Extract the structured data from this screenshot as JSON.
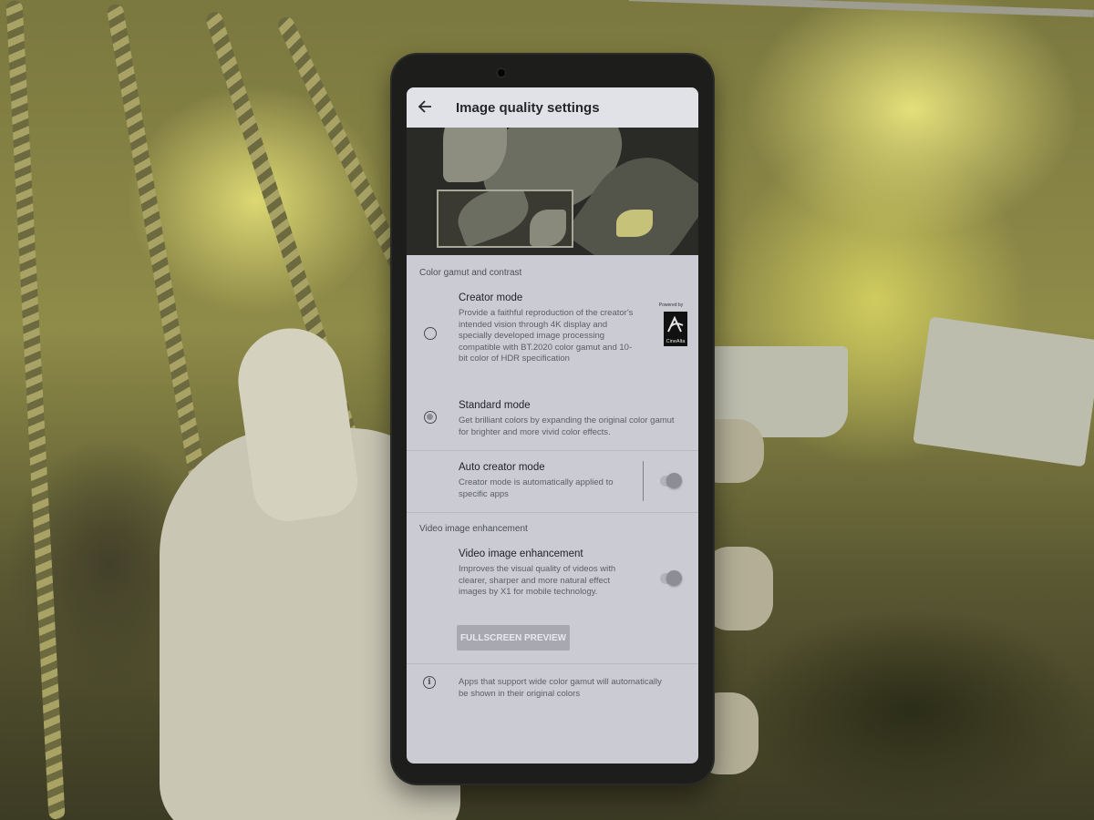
{
  "screen": {
    "title": "Image quality settings",
    "icons": {
      "back": "back-arrow-icon",
      "info": "info-icon"
    },
    "color_gamut": {
      "header": "Color gamut and contrast",
      "creator_mode": {
        "title": "Creator mode",
        "description": "Provide a faithful reproduction of the creator's intended vision through 4K display and specially developed image processing compatible with BT.2020 color gamut and 10-bit color of HDR specification",
        "selected": false,
        "badge_powered": "Powered by",
        "badge_brand": "CineAlta"
      },
      "standard_mode": {
        "title": "Standard mode",
        "description": "Get brilliant colors by expanding the original color gamut for brighter and more vivid color effects.",
        "selected": true
      },
      "auto_creator_mode": {
        "title": "Auto creator mode",
        "description": "Creator mode is automatically applied to specific apps",
        "enabled": true
      }
    },
    "video": {
      "header": "Video image enhancement",
      "enhancement": {
        "title": "Video image enhancement",
        "description": "Improves the visual quality of videos with clearer, sharper and more natural effect images by X1 for mobile technology.",
        "enabled": true
      },
      "preview_button": "FULLSCREEN PREVIEW"
    },
    "info_note": "Apps that support wide color gamut will automatically be shown in their original colors"
  }
}
